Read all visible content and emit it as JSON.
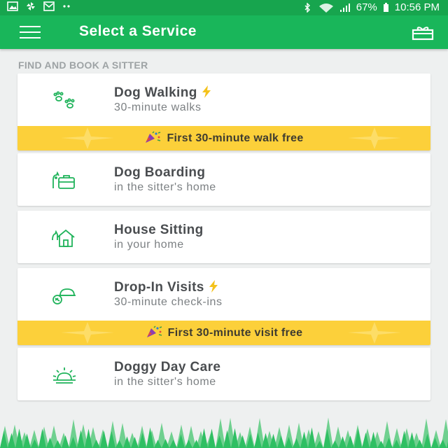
{
  "status_bar": {
    "battery": "67%",
    "time": "10:56 PM",
    "left_icons": [
      "image-icon",
      "pinwheel-icon",
      "mail-icon",
      "more-dots-icon"
    ],
    "right_icons": [
      "bluetooth-icon",
      "wifi-icon",
      "signal-icon",
      "battery-icon"
    ]
  },
  "app_bar": {
    "title": "Select a Service",
    "left_icon": "hamburger-menu-icon",
    "right_icon": "gift-icon"
  },
  "section_heading": "FIND AND BOOK A SITTER",
  "services": [
    {
      "title": "Dog Walking",
      "subtitle": "30-minute walks",
      "icon": "paw-prints-icon",
      "flash": true,
      "promo": "First 30-minute walk free"
    },
    {
      "title": "Dog Boarding",
      "subtitle": "in the sitter's home",
      "icon": "suitcase-icon",
      "flash": false
    },
    {
      "title": "House Sitting",
      "subtitle": "in your home",
      "icon": "house-icon",
      "flash": false
    },
    {
      "title": "Drop-In Visits",
      "subtitle": "30-minute check-ins",
      "icon": "food-bowl-icon",
      "flash": true,
      "promo": "First 30-minute visit free"
    },
    {
      "title": "Doggy Day Care",
      "subtitle": "in the sitter's home",
      "icon": "sun-icon",
      "flash": false
    }
  ],
  "colors": {
    "brand_green": "#19b65a",
    "status_green": "#17a54e",
    "promo_yellow": "#fcd03a",
    "flash_yellow": "#f4c21b",
    "background": "#eef0f0"
  }
}
